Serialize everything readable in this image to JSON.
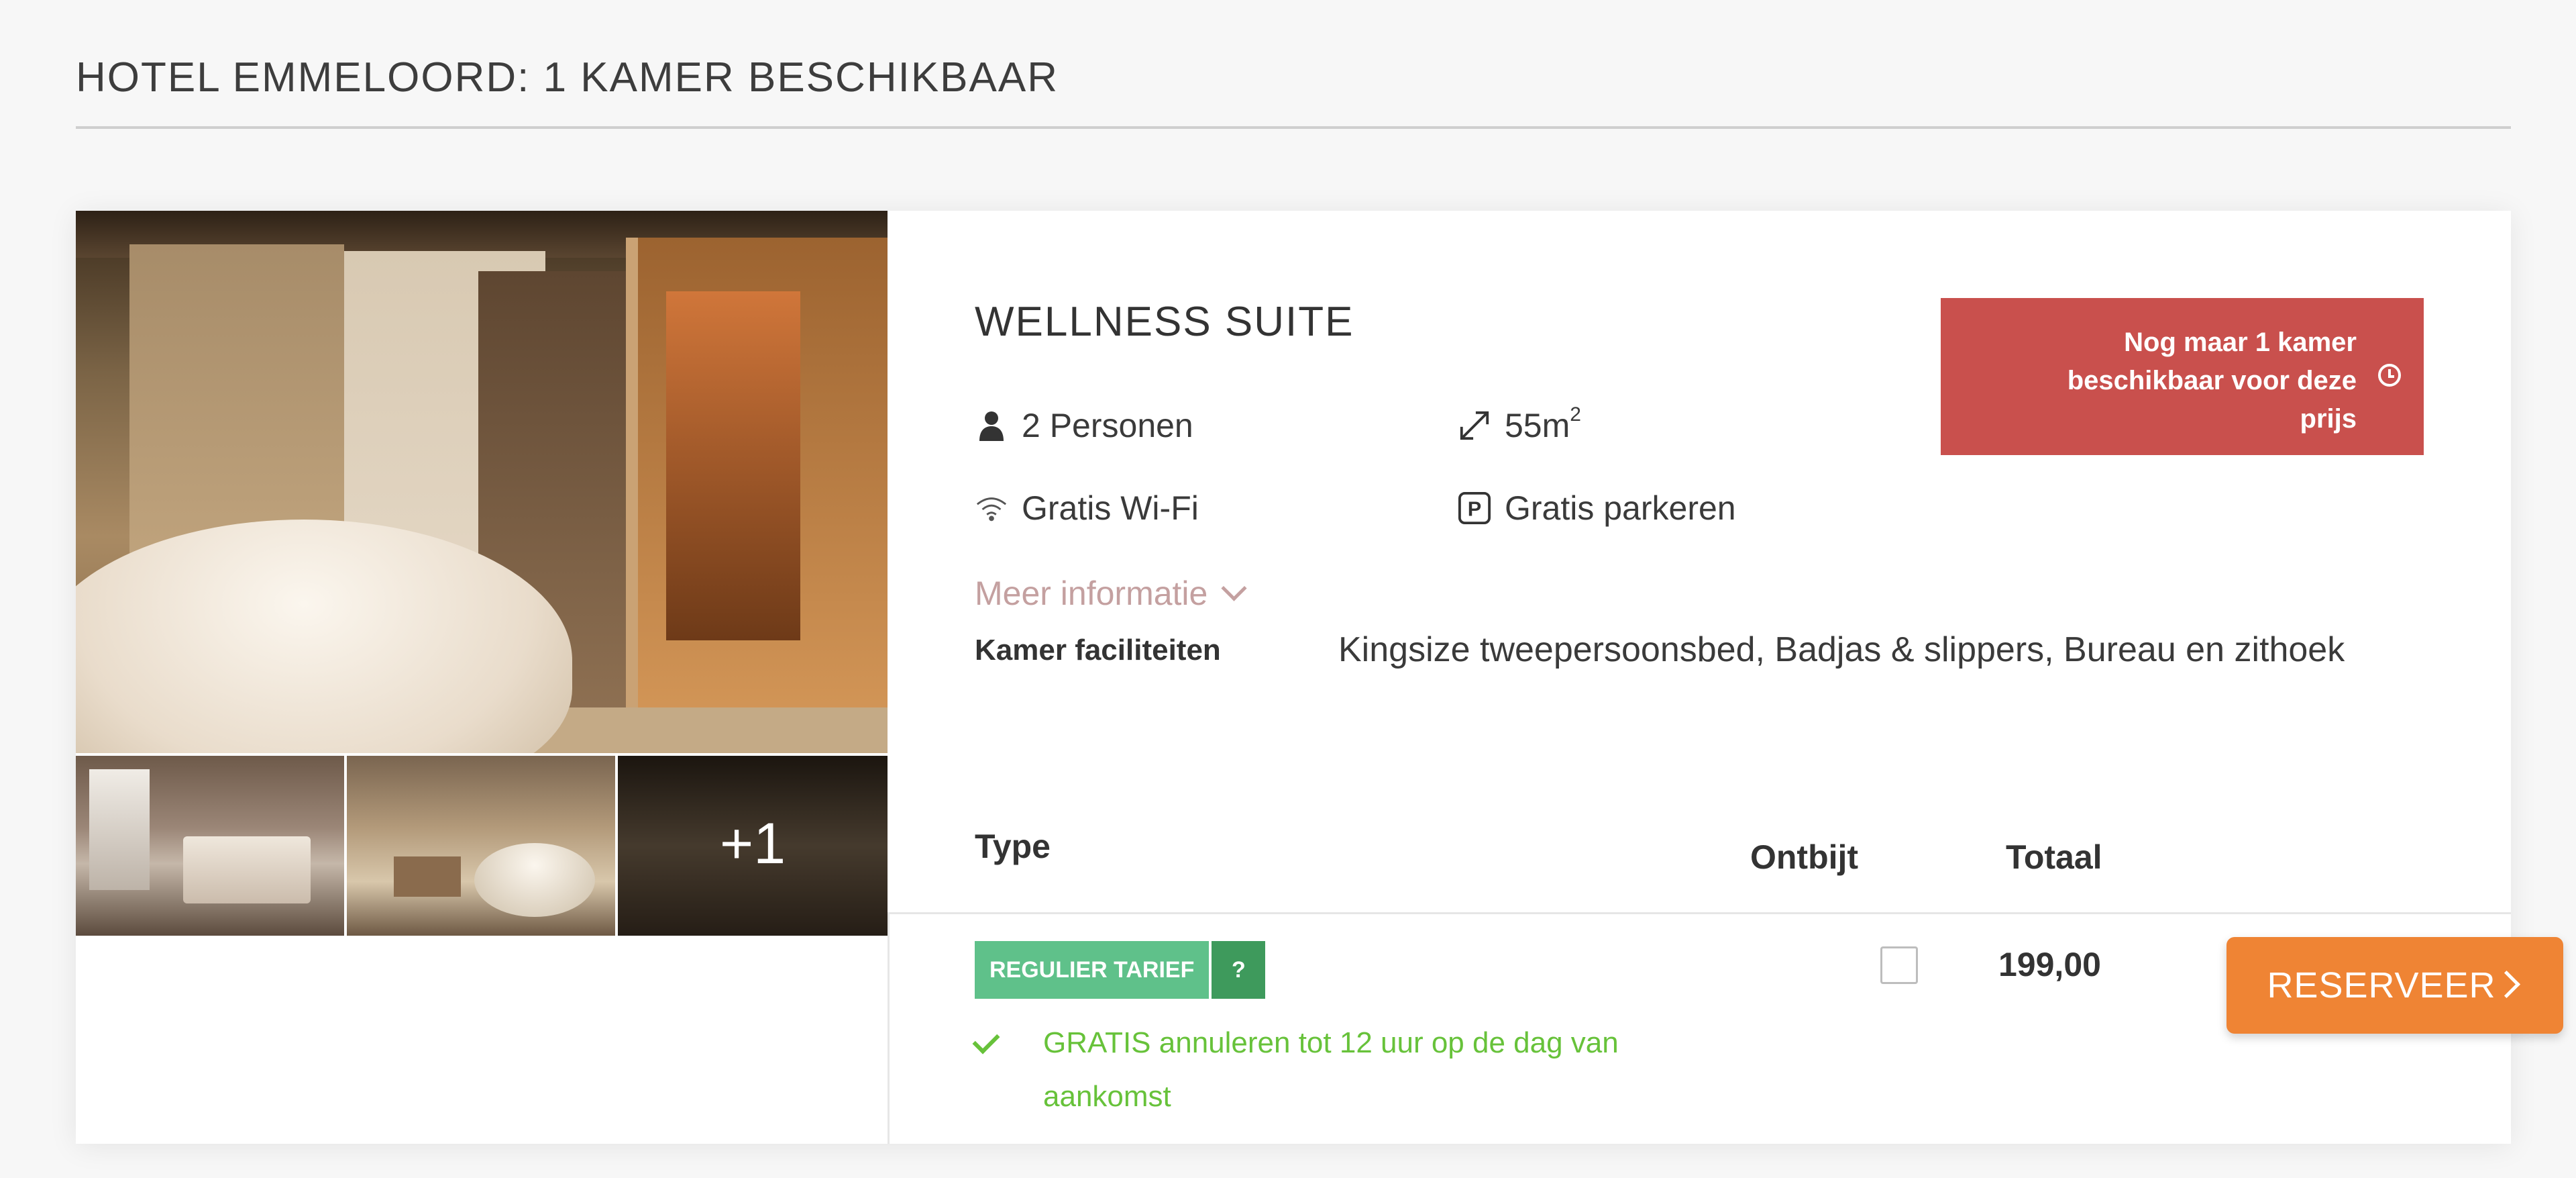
{
  "header": {
    "title": "HOTEL EMMELOORD: 1 KAMER BESCHIKBAAR"
  },
  "room": {
    "title": "WELLNESS SUITE",
    "features": {
      "persons": "2 Personen",
      "size": "55m",
      "size_sup": "2",
      "wifi": "Gratis Wi-Fi",
      "parking": "Gratis parkeren"
    },
    "more_info": "Meer informatie",
    "facilities_label": "Kamer faciliteiten",
    "facilities_value": "Kingsize tweepersoonsbed, Badjas & slippers, Bureau en zithoek",
    "photos_more": "+1",
    "availability_alert": {
      "line1": "Nog maar 1 kamer",
      "line2": "beschikbaar voor deze",
      "line3": "prijs"
    }
  },
  "rates_table": {
    "headers": {
      "type": "Type",
      "breakfast": "Ontbijt",
      "total": "Totaal"
    },
    "rows": [
      {
        "rate_label": "REGULIER TARIEF",
        "help": "?",
        "cancellation": "GRATIS annuleren tot 12 uur op de dag van aankomst",
        "breakfast_checked": false,
        "price": "199,00",
        "button": "RESERVEER"
      }
    ]
  },
  "colors": {
    "alert": "#c9504d",
    "rate_tag": "#5fc18a",
    "rate_help": "#3e9a5c",
    "cancel_text": "#67c23a",
    "reserve_button": "#ef8434",
    "more_info": "#c4a0a0"
  },
  "icons": {
    "persons": "person-icon",
    "size": "resize-arrows-icon",
    "wifi": "wifi-icon",
    "parking": "parking-icon",
    "more_info": "chevron-down-icon",
    "alert": "clock-icon",
    "cancel": "check-icon",
    "reserve": "chevron-right-icon"
  }
}
